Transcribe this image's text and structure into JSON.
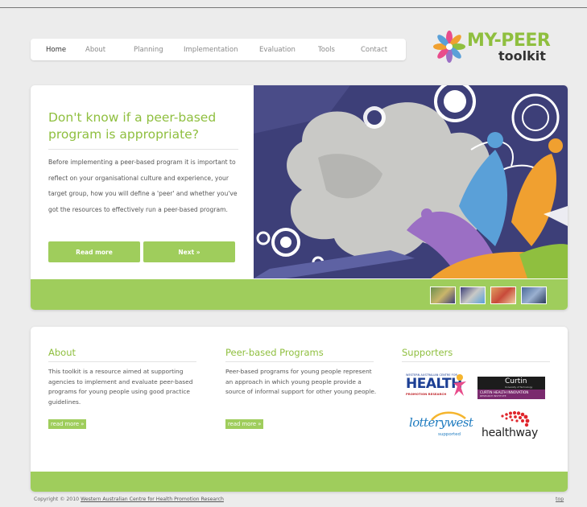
{
  "nav": {
    "items": [
      {
        "label": "Home"
      },
      {
        "label": "About"
      },
      {
        "label": "Planning"
      },
      {
        "label": "Implementation"
      },
      {
        "label": "Evaluation"
      },
      {
        "label": "Tools"
      },
      {
        "label": "Contact"
      }
    ]
  },
  "logo": {
    "line1": "MY-PEER",
    "line2": "toolkit"
  },
  "hero": {
    "title": "Don't know if a peer-based program is appropriate?",
    "body": "Before implementing a peer-based program it is important to reflect on your organisational culture and experience, your target group, how you will define a 'peer' and whether you've got the resources to effectively run a peer-based program.",
    "read_more": "Read more",
    "next": "Next »"
  },
  "about": {
    "title": "About",
    "body": "This toolkit is a resource aimed at supporting agencies to implement and evaluate peer-based programs for young people using good practice guidelines.",
    "link": "read more »"
  },
  "programs": {
    "title": "Peer-based Programs",
    "body": "Peer-based programs for young people represent an approach in which young people provide a source of informal support for other young people.",
    "link": "read more »"
  },
  "supporters": {
    "title": "Supporters",
    "health_top": "WESTERN AUSTRALIAN CENTRE FOR",
    "health": "HEALTH",
    "health_sub": "PROMOTION RESEARCH",
    "curtin": "Curtin",
    "curtin_small": "University of Technology",
    "curtin_sub": "CURTIN HEALTH INNOVATION",
    "curtin_sub2": "RESEARCH INSTITUTE",
    "lotterywest": "lotterywest",
    "lotterywest_sub": "supported",
    "healthway": "healthway"
  },
  "footer": {
    "copyright_prefix": "Copyright © 2010",
    "copyright_link": "Western Australian Centre for Health Promotion Research",
    "top": "top"
  },
  "colors": {
    "accent": "#8fbf3f",
    "bar": "#9fcd5c",
    "navy": "#3d3f78"
  }
}
